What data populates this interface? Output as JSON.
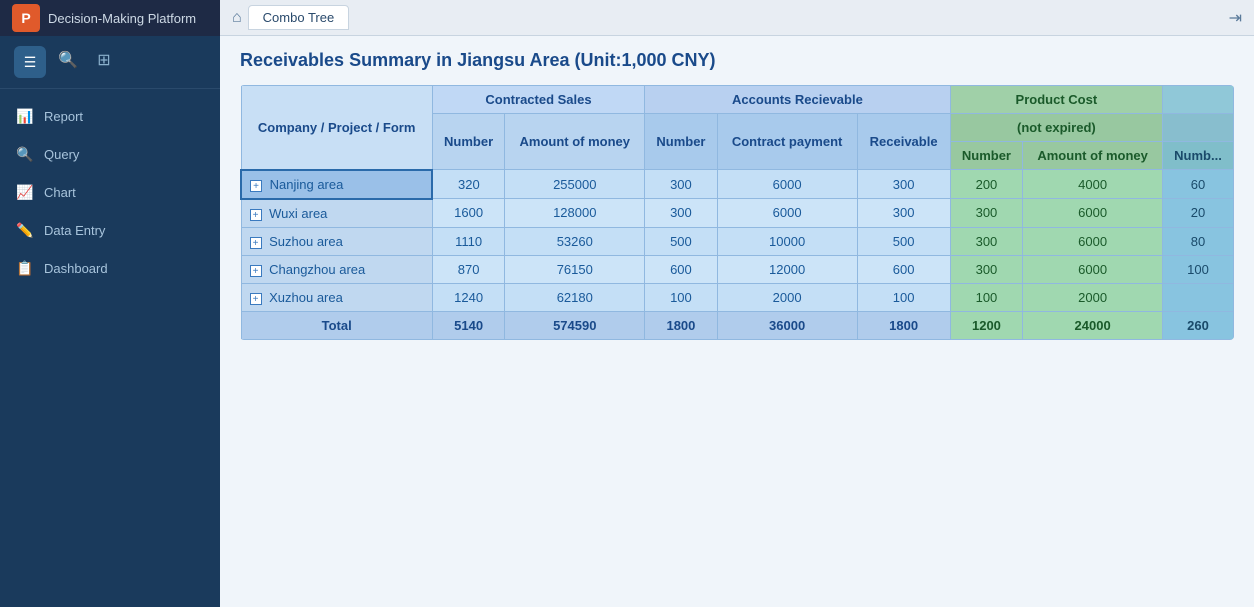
{
  "app": {
    "logo": "P",
    "title": "Decision-Making Platform"
  },
  "sidebar": {
    "items": [
      {
        "id": "report",
        "label": "Report",
        "icon": "📊"
      },
      {
        "id": "query",
        "label": "Query",
        "icon": "🔍"
      },
      {
        "id": "chart",
        "label": "Chart",
        "icon": "📈"
      },
      {
        "id": "data-entry",
        "label": "Data Entry",
        "icon": "✏️"
      },
      {
        "id": "dashboard",
        "label": "Dashboard",
        "icon": "📋"
      }
    ]
  },
  "topbar": {
    "tab": "Combo Tree",
    "home_icon": "⌂"
  },
  "page": {
    "title": "Receivables Summary in Jiangsu Area (Unit:1,000 CNY)"
  },
  "table": {
    "col_groups": [
      {
        "label": "Company / Project / Form",
        "colspan": 1,
        "rowspan": 3
      },
      {
        "label": "Contracted Sales",
        "colspan": 2
      },
      {
        "label": "Accounts Recievable",
        "colspan": 3
      },
      {
        "label": "Product Cost",
        "colspan": 2,
        "class": "green"
      }
    ],
    "sub_groups": [
      {
        "label": "(not expired)",
        "colspan": 2,
        "class": "green"
      }
    ],
    "columns": [
      "Number",
      "Amount of money",
      "Number",
      "Contract payment",
      "Receivable",
      "Number",
      "Amount of money",
      "Numb..."
    ],
    "rows": [
      {
        "area": "Nanjing area",
        "selected": true,
        "expand": "+",
        "c1": "320",
        "c2": "255000",
        "c3": "300",
        "c4": "6000",
        "c5": "300",
        "c6": "200",
        "c7": "4000",
        "c8": "60"
      },
      {
        "area": "Wuxi area",
        "selected": false,
        "expand": "+",
        "c1": "1600",
        "c2": "128000",
        "c3": "300",
        "c4": "6000",
        "c5": "300",
        "c6": "300",
        "c7": "6000",
        "c8": "20"
      },
      {
        "area": "Suzhou area",
        "selected": false,
        "expand": "+",
        "c1": "1110",
        "c2": "53260",
        "c3": "500",
        "c4": "10000",
        "c5": "500",
        "c6": "300",
        "c7": "6000",
        "c8": "80"
      },
      {
        "area": "Changzhou area",
        "selected": false,
        "expand": "+",
        "c1": "870",
        "c2": "76150",
        "c3": "600",
        "c4": "12000",
        "c5": "600",
        "c6": "300",
        "c7": "6000",
        "c8": "100"
      },
      {
        "area": "Xuzhou area",
        "selected": false,
        "expand": "+",
        "c1": "1240",
        "c2": "62180",
        "c3": "100",
        "c4": "2000",
        "c5": "100",
        "c6": "100",
        "c7": "2000",
        "c8": ""
      }
    ],
    "total": {
      "label": "Total",
      "c1": "5140",
      "c2": "574590",
      "c3": "1800",
      "c4": "36000",
      "c5": "1800",
      "c6": "1200",
      "c7": "24000",
      "c8": "260"
    }
  }
}
